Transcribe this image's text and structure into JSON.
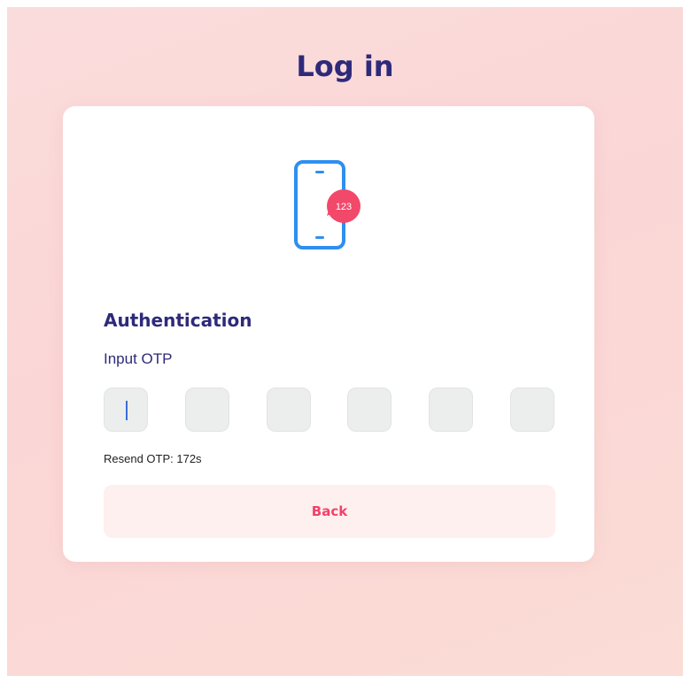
{
  "page": {
    "title": "Log in"
  },
  "card": {
    "illustration": {
      "icon": "smartphone-otp-icon",
      "badge_text": "123",
      "phone_color": "#2f8ff0",
      "badge_color": "#f2486a"
    },
    "heading": "Authentication",
    "otp_label": "Input OTP",
    "otp_inputs": [
      {
        "value": "",
        "focused": true
      },
      {
        "value": "",
        "focused": false
      },
      {
        "value": "",
        "focused": false
      },
      {
        "value": "",
        "focused": false
      },
      {
        "value": "",
        "focused": false
      },
      {
        "value": "",
        "focused": false
      }
    ],
    "resend_text": "Resend OTP: 172s",
    "back_label": "Back"
  },
  "colors": {
    "title": "#2e2a7a",
    "accent": "#f2416b",
    "background": "#fbdcdc"
  }
}
